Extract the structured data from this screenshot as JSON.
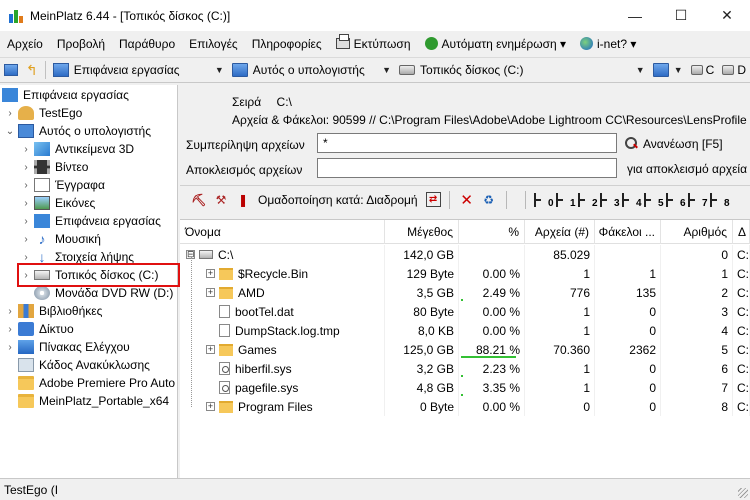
{
  "window": {
    "title": "MeinPlatz 6.44 - [Τοπικός δίσκος (C:)]",
    "minimize": "—",
    "maximize": "☐",
    "close": "✕"
  },
  "menu": [
    {
      "label": "Αρχείο"
    },
    {
      "label": "Προβολή"
    },
    {
      "label": "Παράθυρο"
    },
    {
      "label": "Επιλογές"
    },
    {
      "label": "Πληροφορίες"
    },
    {
      "label": "Εκτύπωση",
      "icon": "printer-icon"
    },
    {
      "label": "Αυτόματη ενημέρωση ▾",
      "icon": "refresh-icon"
    },
    {
      "label": "i-net? ▾",
      "icon": "globe-icon"
    }
  ],
  "toolbar1": {
    "desktop": "Επιφάνεια εργασίας",
    "computer": "Αυτός ο υπολογιστής",
    "drive": "Τοπικός δίσκος (C:)",
    "arrow": "▼",
    "extra1": "C",
    "extra2": "D"
  },
  "tree": [
    {
      "label": "Επιφάνεια εργασίας",
      "icon": "desk",
      "indent": 0,
      "chev": ""
    },
    {
      "label": "TestEgo",
      "icon": "user",
      "indent": 1,
      "chev": "›"
    },
    {
      "label": "Αυτός ο υπολογιστής",
      "icon": "pc",
      "indent": 1,
      "chev": "⌄"
    },
    {
      "label": "Αντικείμενα 3D",
      "icon": "cube",
      "indent": 2,
      "chev": "›"
    },
    {
      "label": "Βίντεο",
      "icon": "film",
      "indent": 2,
      "chev": "›"
    },
    {
      "label": "Έγγραφα",
      "icon": "doc",
      "indent": 2,
      "chev": "›"
    },
    {
      "label": "Εικόνες",
      "icon": "img",
      "indent": 2,
      "chev": "›"
    },
    {
      "label": "Επιφάνεια εργασίας",
      "icon": "desk",
      "indent": 2,
      "chev": "›"
    },
    {
      "label": "Μουσική",
      "icon": "music",
      "indent": 2,
      "chev": "›"
    },
    {
      "label": "Στοιχεία λήψης",
      "icon": "down",
      "indent": 2,
      "chev": "›"
    },
    {
      "label": "Τοπικός δίσκος (C:)",
      "icon": "drive",
      "indent": 2,
      "chev": "›"
    },
    {
      "label": "Μονάδα DVD RW (D:)",
      "icon": "dvd",
      "indent": 2,
      "chev": ""
    },
    {
      "label": "Βιβλιοθήκες",
      "icon": "lib",
      "indent": 1,
      "chev": "›"
    },
    {
      "label": "Δίκτυο",
      "icon": "net",
      "indent": 1,
      "chev": "›"
    },
    {
      "label": "Πίνακας Ελέγχου",
      "icon": "ctrl",
      "indent": 1,
      "chev": "›"
    },
    {
      "label": "Κάδος Ανακύκλωσης",
      "icon": "bin",
      "indent": 1,
      "chev": ""
    },
    {
      "label": "Adobe Premiere Pro Auto",
      "icon": "folder",
      "indent": 1,
      "chev": ""
    },
    {
      "label": "MeinPlatz_Portable_x64",
      "icon": "folder",
      "indent": 1,
      "chev": ""
    }
  ],
  "info": {
    "row_label": "Σειρά",
    "row_value": "C:\\",
    "files_folders": "Αρχεία & Φάκελοι: 90599 // C:\\Program Files\\Adobe\\Adobe Lightroom CC\\Resources\\LensProfile"
  },
  "filters": {
    "include_label": "Συμπερίληψη αρχείων",
    "include_value": "*",
    "exclude_label": "Αποκλεισμός αρχείων",
    "exclude_value": "",
    "refresh_label": "Ανανέωση [F5]",
    "exclude_hint": "για αποκλεισμό αρχεία"
  },
  "toolbar2": {
    "group_label": "Ομαδοποίηση κατά: Διαδρομή",
    "levels": [
      "0",
      "1",
      "2",
      "3",
      "4",
      "5",
      "6",
      "7",
      "8"
    ]
  },
  "table": {
    "columns": [
      "Όνομα",
      "Μέγεθος",
      "%",
      "Αρχεία (#)",
      "Φάκελοι ...",
      "Αριθμός",
      "Δ"
    ],
    "rows": [
      {
        "name": "C:\\",
        "icon": "drive",
        "expander": "⊟",
        "size": "142,0 GB",
        "pct": "",
        "pct_value": 0,
        "files": "85.029",
        "folders": "",
        "num": "0",
        "d": "C:\\"
      },
      {
        "name": "$Recycle.Bin",
        "icon": "folder",
        "expander": "+",
        "size": "129 Byte",
        "pct": "0.00 %",
        "pct_value": 0.0,
        "files": "1",
        "folders": "1",
        "num": "1",
        "d": "C:\\"
      },
      {
        "name": "AMD",
        "icon": "folder",
        "expander": "+",
        "size": "3,5 GB",
        "pct": "2.49 %",
        "pct_value": 2.49,
        "files": "776",
        "folders": "135",
        "num": "2",
        "d": "C:\\"
      },
      {
        "name": "bootTel.dat",
        "icon": "file",
        "expander": "",
        "size": "80 Byte",
        "pct": "0.00 %",
        "pct_value": 0.0,
        "files": "1",
        "folders": "0",
        "num": "3",
        "d": "C:\\"
      },
      {
        "name": "DumpStack.log.tmp",
        "icon": "file",
        "expander": "",
        "size": "8,0 KB",
        "pct": "0.00 %",
        "pct_value": 0.0,
        "files": "1",
        "folders": "0",
        "num": "4",
        "d": "C:\\"
      },
      {
        "name": "Games",
        "icon": "folder",
        "expander": "+",
        "size": "125,0 GB",
        "pct": "88.21 %",
        "pct_value": 88.21,
        "files": "70.360",
        "folders": "2362",
        "num": "5",
        "d": "C:\\"
      },
      {
        "name": "hiberfil.sys",
        "icon": "sys",
        "expander": "",
        "size": "3,2 GB",
        "pct": "2.23 %",
        "pct_value": 2.23,
        "files": "1",
        "folders": "0",
        "num": "6",
        "d": "C:\\"
      },
      {
        "name": "pagefile.sys",
        "icon": "sys",
        "expander": "",
        "size": "4,8 GB",
        "pct": "3.35 %",
        "pct_value": 3.35,
        "files": "1",
        "folders": "0",
        "num": "7",
        "d": "C:\\"
      },
      {
        "name": "Program Files",
        "icon": "folder",
        "expander": "+",
        "size": "0 Byte",
        "pct": "0.00 %",
        "pct_value": 0.0,
        "files": "0",
        "folders": "0",
        "num": "8",
        "d": "C:\\"
      }
    ]
  },
  "status": {
    "text": "TestEgo (I"
  }
}
